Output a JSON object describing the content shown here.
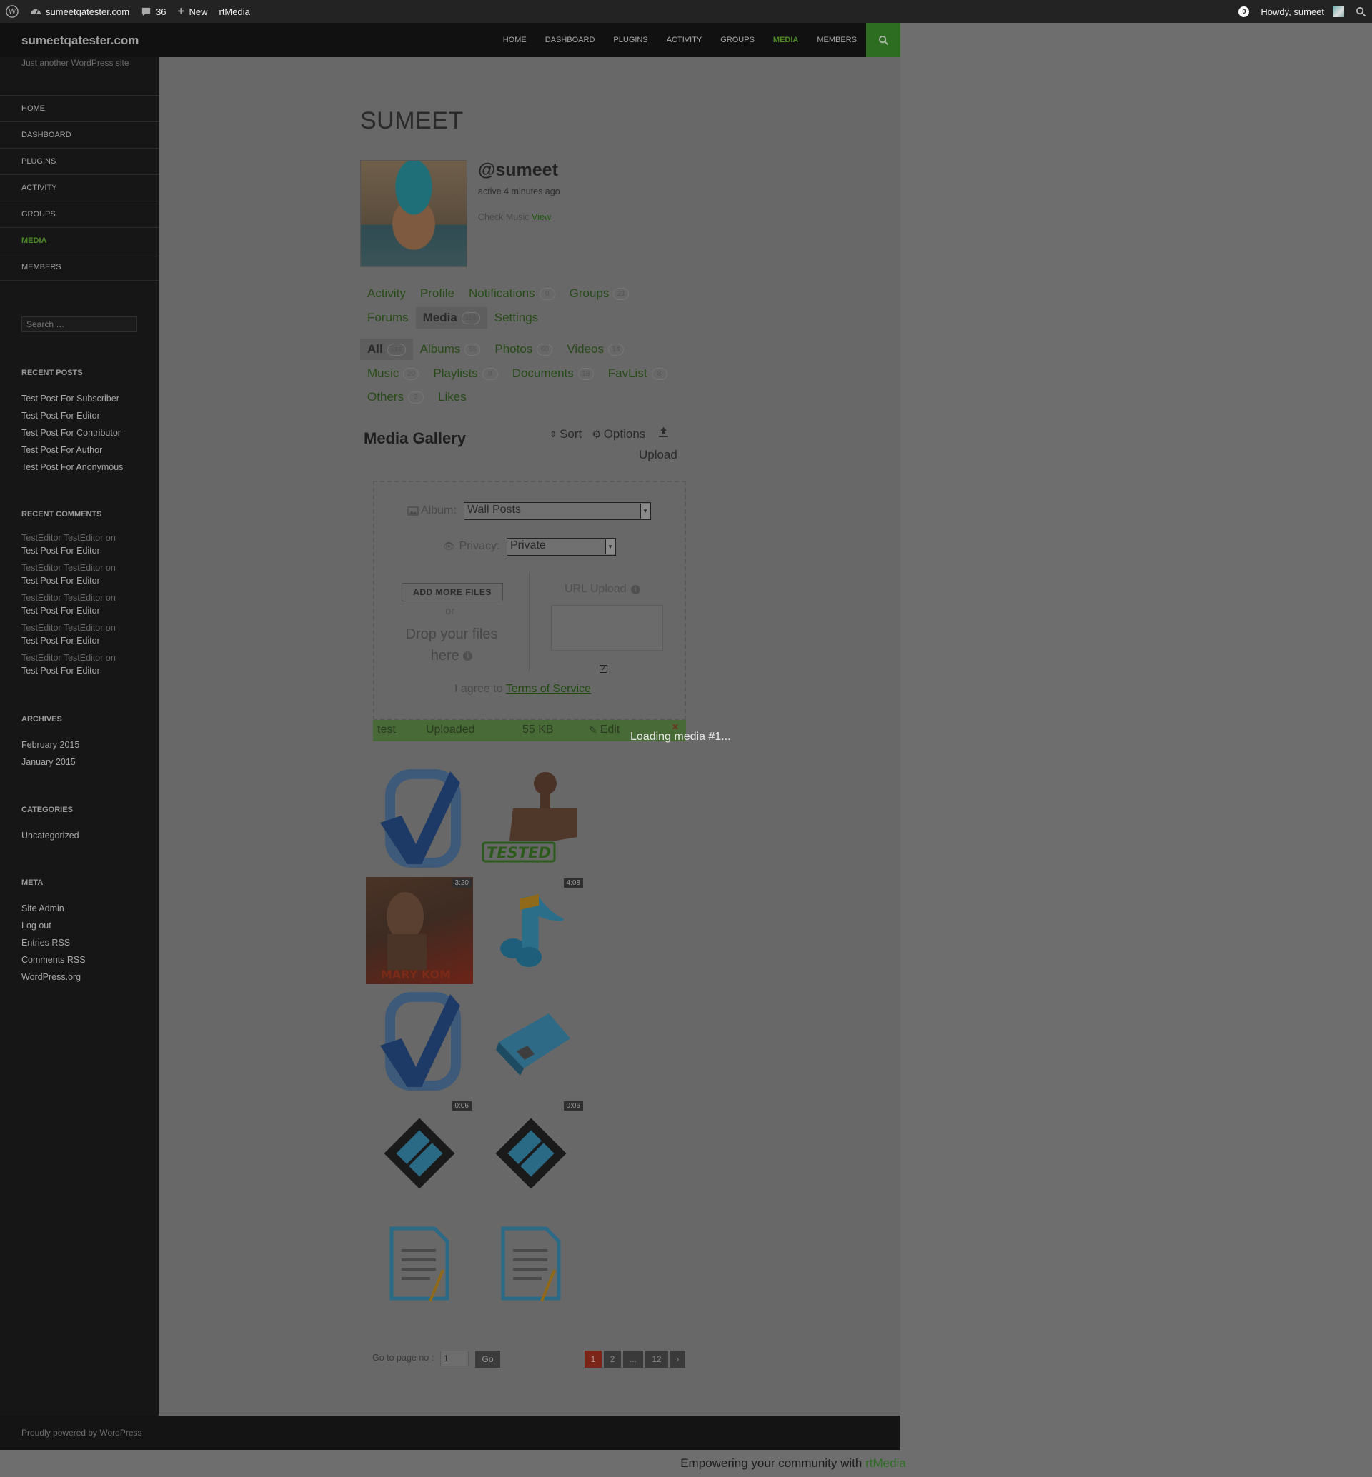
{
  "admin_bar": {
    "site": "sumeetqatester.com",
    "comments_count": "36",
    "new_label": "New",
    "rtmedia_label": "rtMedia",
    "notifications": "0",
    "howdy": "Howdy, sumeet"
  },
  "header": {
    "site_title": "sumeetqatester.com",
    "tagline": "Just another WordPress site",
    "nav": [
      "HOME",
      "DASHBOARD",
      "PLUGINS",
      "ACTIVITY",
      "GROUPS",
      "MEDIA",
      "MEMBERS"
    ],
    "active_nav": "MEDIA"
  },
  "sidebar": {
    "nav": [
      "HOME",
      "DASHBOARD",
      "PLUGINS",
      "ACTIVITY",
      "GROUPS",
      "MEDIA",
      "MEMBERS"
    ],
    "search_placeholder": "Search …",
    "recent_posts_title": "RECENT POSTS",
    "recent_posts": [
      "Test Post For Subscriber",
      "Test Post For Editor",
      "Test Post For Contributor",
      "Test Post For Author",
      "Test Post For Anonymous"
    ],
    "recent_comments_title": "RECENT COMMENTS",
    "recent_comments": [
      {
        "who": "TestEditor TestEditor on",
        "post": "Test Post For Editor"
      },
      {
        "who": "TestEditor TestEditor on",
        "post": "Test Post For Editor"
      },
      {
        "who": "TestEditor TestEditor on",
        "post": "Test Post For Editor"
      },
      {
        "who": "TestEditor TestEditor on",
        "post": "Test Post For Editor"
      },
      {
        "who": "TestEditor TestEditor on",
        "post": "Test Post For Editor"
      }
    ],
    "archives_title": "ARCHIVES",
    "archives": [
      "February 2015",
      "January 2015"
    ],
    "categories_title": "CATEGORIES",
    "categories": [
      "Uncategorized"
    ],
    "meta_title": "META",
    "meta": [
      "Site Admin",
      "Log out",
      "Entries RSS",
      "Comments RSS",
      "WordPress.org"
    ]
  },
  "profile": {
    "title": "SUMEET",
    "handle": "@sumeet",
    "last_active": "active 4 minutes ago",
    "status_text": "Check Music",
    "status_link": "View"
  },
  "profile_tabs": [
    {
      "label": "Activity",
      "count": ""
    },
    {
      "label": "Profile",
      "count": ""
    },
    {
      "label": "Notifications",
      "count": "0"
    },
    {
      "label": "Groups",
      "count": "21"
    },
    {
      "label": "Forums",
      "count": ""
    },
    {
      "label": "Media",
      "count": "114"
    },
    {
      "label": "Settings",
      "count": ""
    }
  ],
  "media_tabs": [
    {
      "label": "All",
      "count": "114"
    },
    {
      "label": "Albums",
      "count": "55"
    },
    {
      "label": "Photos",
      "count": "60"
    },
    {
      "label": "Videos",
      "count": "14"
    },
    {
      "label": "Music",
      "count": "20"
    },
    {
      "label": "Playlists",
      "count": "8"
    },
    {
      "label": "Documents",
      "count": "18"
    },
    {
      "label": "FavList",
      "count": "8"
    },
    {
      "label": "Others",
      "count": "2"
    },
    {
      "label": "Likes",
      "count": ""
    }
  ],
  "gallery": {
    "title": "Media Gallery",
    "sort_label": "Sort",
    "options_label": "Options",
    "upload_label": "Upload"
  },
  "uploader": {
    "album_label": "Album:",
    "album_value": "Wall Posts",
    "privacy_label": "Privacy:",
    "privacy_value": "Private",
    "add_files_label": "ADD MORE FILES",
    "or_label": "or",
    "drop_label": "Drop your files here",
    "url_label": "URL Upload",
    "terms_prefix": "I agree to",
    "terms_link": "Terms of Service"
  },
  "upload_item": {
    "name": "test",
    "status": "Uploaded",
    "size": "55 KB",
    "edit_label": "Edit",
    "remove": "×"
  },
  "thumbnails": [
    {
      "kind": "checkmark",
      "duration": ""
    },
    {
      "kind": "stamp",
      "stamp_text": "TESTED",
      "duration": ""
    },
    {
      "kind": "movie-poster",
      "poster_text": "MARY KOM",
      "duration": "3:20"
    },
    {
      "kind": "music-note",
      "duration": "4:08"
    },
    {
      "kind": "checkmark",
      "duration": ""
    },
    {
      "kind": "folder",
      "duration": ""
    },
    {
      "kind": "film",
      "duration": "0:06"
    },
    {
      "kind": "film",
      "duration": "0:06"
    },
    {
      "kind": "document",
      "duration": ""
    },
    {
      "kind": "document",
      "duration": ""
    }
  ],
  "pagination": {
    "goto_label": "Go to page no :",
    "goto_value": "1",
    "go_label": "Go",
    "pages": [
      "1",
      "2",
      "...",
      "12",
      "›"
    ]
  },
  "loading_text": "Loading media #1...",
  "footer": {
    "credit": "Proudly powered by WordPress",
    "empowering_prefix": "Empowering your community with ",
    "brand": "rtMedia"
  },
  "colors": {
    "accent_green": "#2d6d22",
    "overlay": "#686868",
    "current_page": "#7a2517"
  }
}
